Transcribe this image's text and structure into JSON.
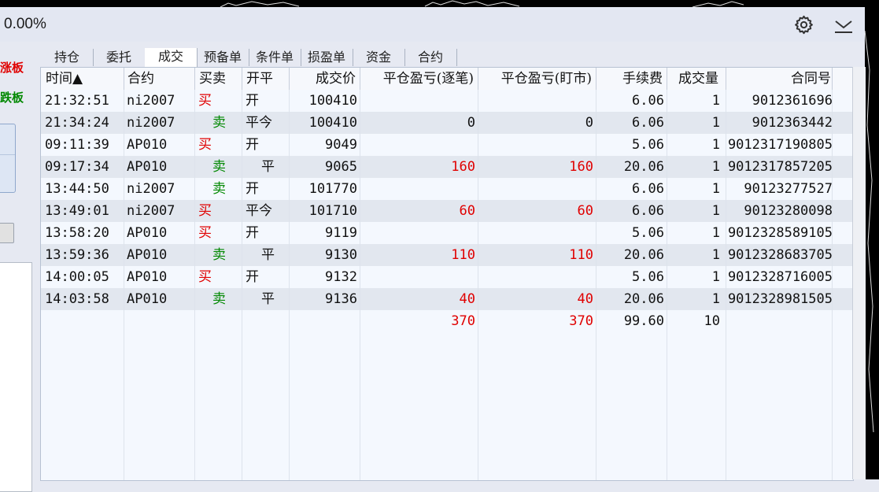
{
  "title_bar": {
    "percent": "0.00%"
  },
  "left_panel": {
    "limit_up": "涨板",
    "limit_down": "跌板"
  },
  "tabs": [
    "持仓",
    "委托",
    "成交",
    "预备单",
    "条件单",
    "损盈单",
    "资金",
    "合约"
  ],
  "active_tab": 2,
  "columns": [
    "时间▲",
    "合约",
    "买卖",
    "开平",
    "成交价",
    "平仓盈亏(逐笔)",
    "平仓盈亏(盯市)",
    "手续费",
    "成交量",
    "合同号"
  ],
  "rows": [
    {
      "time": "21:32:51",
      "contract": "ni2007",
      "side": "买",
      "openclose": "开",
      "price": "100410",
      "pnl_trade": "",
      "pnl_mark": "",
      "fee": "6.06",
      "qty": "1",
      "order_no": "9012361696"
    },
    {
      "time": "21:34:24",
      "contract": "ni2007",
      "side": "卖",
      "openclose": "平今",
      "price": "100410",
      "pnl_trade": "0",
      "pnl_mark": "0",
      "fee": "6.06",
      "qty": "1",
      "order_no": "9012363442"
    },
    {
      "time": "09:11:39",
      "contract": "AP010",
      "side": "买",
      "openclose": "开",
      "price": "9049",
      "pnl_trade": "",
      "pnl_mark": "",
      "fee": "5.06",
      "qty": "1",
      "order_no": "9012317190805"
    },
    {
      "time": "09:17:34",
      "contract": "AP010",
      "side": "卖",
      "openclose": "平",
      "price": "9065",
      "pnl_trade": "160",
      "pnl_mark": "160",
      "fee": "20.06",
      "qty": "1",
      "order_no": "9012317857205"
    },
    {
      "time": "13:44:50",
      "contract": "ni2007",
      "side": "卖",
      "openclose": "开",
      "price": "101770",
      "pnl_trade": "",
      "pnl_mark": "",
      "fee": "6.06",
      "qty": "1",
      "order_no": "90123277527"
    },
    {
      "time": "13:49:01",
      "contract": "ni2007",
      "side": "买",
      "openclose": "平今",
      "price": "101710",
      "pnl_trade": "60",
      "pnl_mark": "60",
      "fee": "6.06",
      "qty": "1",
      "order_no": "90123280098"
    },
    {
      "time": "13:58:20",
      "contract": "AP010",
      "side": "买",
      "openclose": "开",
      "price": "9119",
      "pnl_trade": "",
      "pnl_mark": "",
      "fee": "5.06",
      "qty": "1",
      "order_no": "9012328589105"
    },
    {
      "time": "13:59:36",
      "contract": "AP010",
      "side": "卖",
      "openclose": "平",
      "price": "9130",
      "pnl_trade": "110",
      "pnl_mark": "110",
      "fee": "20.06",
      "qty": "1",
      "order_no": "9012328683705"
    },
    {
      "time": "14:00:05",
      "contract": "AP010",
      "side": "买",
      "openclose": "开",
      "price": "9132",
      "pnl_trade": "",
      "pnl_mark": "",
      "fee": "5.06",
      "qty": "1",
      "order_no": "9012328716005"
    },
    {
      "time": "14:03:58",
      "contract": "AP010",
      "side": "卖",
      "openclose": "平",
      "price": "9136",
      "pnl_trade": "40",
      "pnl_mark": "40",
      "fee": "20.06",
      "qty": "1",
      "order_no": "9012328981505"
    }
  ],
  "totals": {
    "pnl_trade": "370",
    "pnl_mark": "370",
    "fee": "99.60",
    "qty": "10"
  },
  "colors": {
    "buy": "#e00000",
    "sell": "#008800",
    "profit": "#e00000"
  },
  "icons": {
    "settings": "gear-icon",
    "collapse": "chevron-down-icon"
  }
}
